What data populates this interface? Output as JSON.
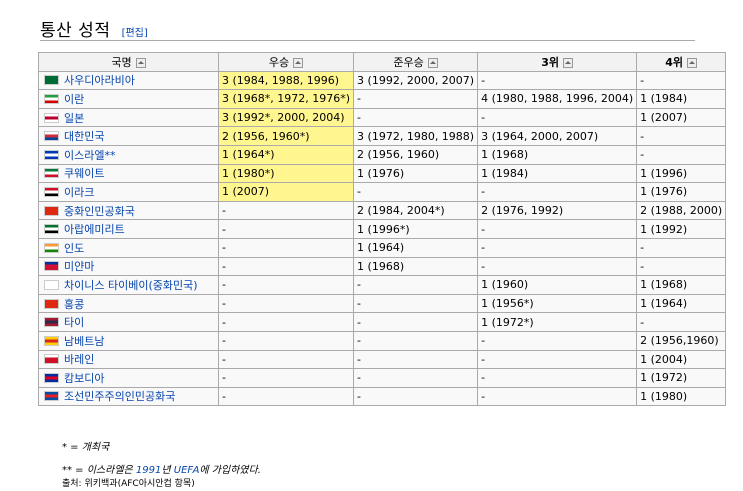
{
  "heading": {
    "title": "통산 성적",
    "edit_label": "[편집]"
  },
  "table": {
    "headers": [
      "국명",
      "우승",
      "준우승",
      "3위",
      "4위"
    ],
    "rows": [
      {
        "country": "사우디아라비아",
        "flag_colors": [
          "#006c35",
          "#006c35",
          "#006c35"
        ],
        "win": "3 (1984, 1988, 1996)",
        "runner": "3 (1992, 2000, 2007)",
        "third": "-",
        "fourth": "-"
      },
      {
        "country": "이란",
        "flag_colors": [
          "#239f40",
          "#ffffff",
          "#da0000"
        ],
        "win": "3 (1968*, 1972, 1976*)",
        "runner": "-",
        "third": "4 (1980, 1988, 1996, 2004)",
        "fourth": "1 (1984)"
      },
      {
        "country": "일본",
        "flag_colors": [
          "#ffffff",
          "#bc002d",
          "#ffffff"
        ],
        "win": "3 (1992*, 2000, 2004)",
        "runner": "-",
        "third": "-",
        "fourth": "1 (2007)"
      },
      {
        "country": "대한민국",
        "flag_colors": [
          "#ffffff",
          "#cd2e3a",
          "#0047a0"
        ],
        "win": "2 (1956, 1960*)",
        "runner": "3 (1972, 1980, 1988)",
        "third": "3 (1964, 2000, 2007)",
        "fourth": "-"
      },
      {
        "country": "이스라엘**",
        "flag_colors": [
          "#0038b8",
          "#ffffff",
          "#0038b8"
        ],
        "win": "1 (1964*)",
        "runner": "2 (1956, 1960)",
        "third": "1 (1968)",
        "fourth": "-"
      },
      {
        "country": "쿠웨이트",
        "flag_colors": [
          "#007a3d",
          "#ffffff",
          "#ce1126"
        ],
        "win": "1 (1980*)",
        "runner": "1 (1976)",
        "third": "1 (1984)",
        "fourth": "1 (1996)"
      },
      {
        "country": "이라크",
        "flag_colors": [
          "#ce1126",
          "#ffffff",
          "#000000"
        ],
        "win": "1 (2007)",
        "runner": "-",
        "third": "-",
        "fourth": "1 (1976)"
      },
      {
        "country": "중화인민공화국",
        "flag_colors": [
          "#de2910",
          "#de2910",
          "#de2910"
        ],
        "win": "-",
        "runner": "2 (1984, 2004*)",
        "third": "2 (1976, 1992)",
        "fourth": "2 (1988, 2000)"
      },
      {
        "country": "아랍에미리트",
        "flag_colors": [
          "#00732f",
          "#ffffff",
          "#000000"
        ],
        "win": "-",
        "runner": "1 (1996*)",
        "third": "-",
        "fourth": "1 (1992)"
      },
      {
        "country": "인도",
        "flag_colors": [
          "#ff9933",
          "#ffffff",
          "#138808"
        ],
        "win": "-",
        "runner": "1 (1964)",
        "third": "-",
        "fourth": "-"
      },
      {
        "country": "미얀마",
        "flag_colors": [
          "#0033a0",
          "#d21034",
          "#d21034"
        ],
        "win": "-",
        "runner": "1 (1968)",
        "third": "-",
        "fourth": "-"
      },
      {
        "country": "차이니스 타이베이(중화민국)",
        "flag_colors": [
          "#ffffff",
          "#ffffff",
          "#ffffff"
        ],
        "win": "-",
        "runner": "-",
        "third": "1 (1960)",
        "fourth": "1 (1968)"
      },
      {
        "country": "홍콩",
        "flag_colors": [
          "#de2910",
          "#de2910",
          "#de2910"
        ],
        "win": "-",
        "runner": "-",
        "third": "1 (1956*)",
        "fourth": "1 (1964)"
      },
      {
        "country": "타이",
        "flag_colors": [
          "#a51931",
          "#2d2a4a",
          "#a51931"
        ],
        "win": "-",
        "runner": "-",
        "third": "1 (1972*)",
        "fourth": "-"
      },
      {
        "country": "남베트남",
        "flag_colors": [
          "#ffcd00",
          "#da251d",
          "#ffcd00"
        ],
        "win": "-",
        "runner": "-",
        "third": "-",
        "fourth": "2 (1956,1960)"
      },
      {
        "country": "바레인",
        "flag_colors": [
          "#ffffff",
          "#ce1126",
          "#ce1126"
        ],
        "win": "-",
        "runner": "-",
        "third": "-",
        "fourth": "1 (2004)"
      },
      {
        "country": "캄보디아",
        "flag_colors": [
          "#032ea1",
          "#e00025",
          "#032ea1"
        ],
        "win": "-",
        "runner": "-",
        "third": "-",
        "fourth": "1 (1972)"
      },
      {
        "country": "조선민주주의인민공화국",
        "flag_colors": [
          "#024fa2",
          "#ed1c27",
          "#024fa2"
        ],
        "win": "-",
        "runner": "-",
        "third": "-",
        "fourth": "1 (1980)"
      }
    ]
  },
  "notes": {
    "host": "* = 개최국",
    "israel_prefix": "** = 이스라엘은 ",
    "israel_year": "1991",
    "israel_mid": "년 ",
    "israel_org": "UEFA",
    "israel_suffix": "에 가입하였다.",
    "source": "출처: 위키백과(AFC아시안컵 항목)"
  },
  "colors": {
    "winner_highlight": "#fff68f",
    "link": "#0645ad",
    "border": "#aaaaaa"
  }
}
